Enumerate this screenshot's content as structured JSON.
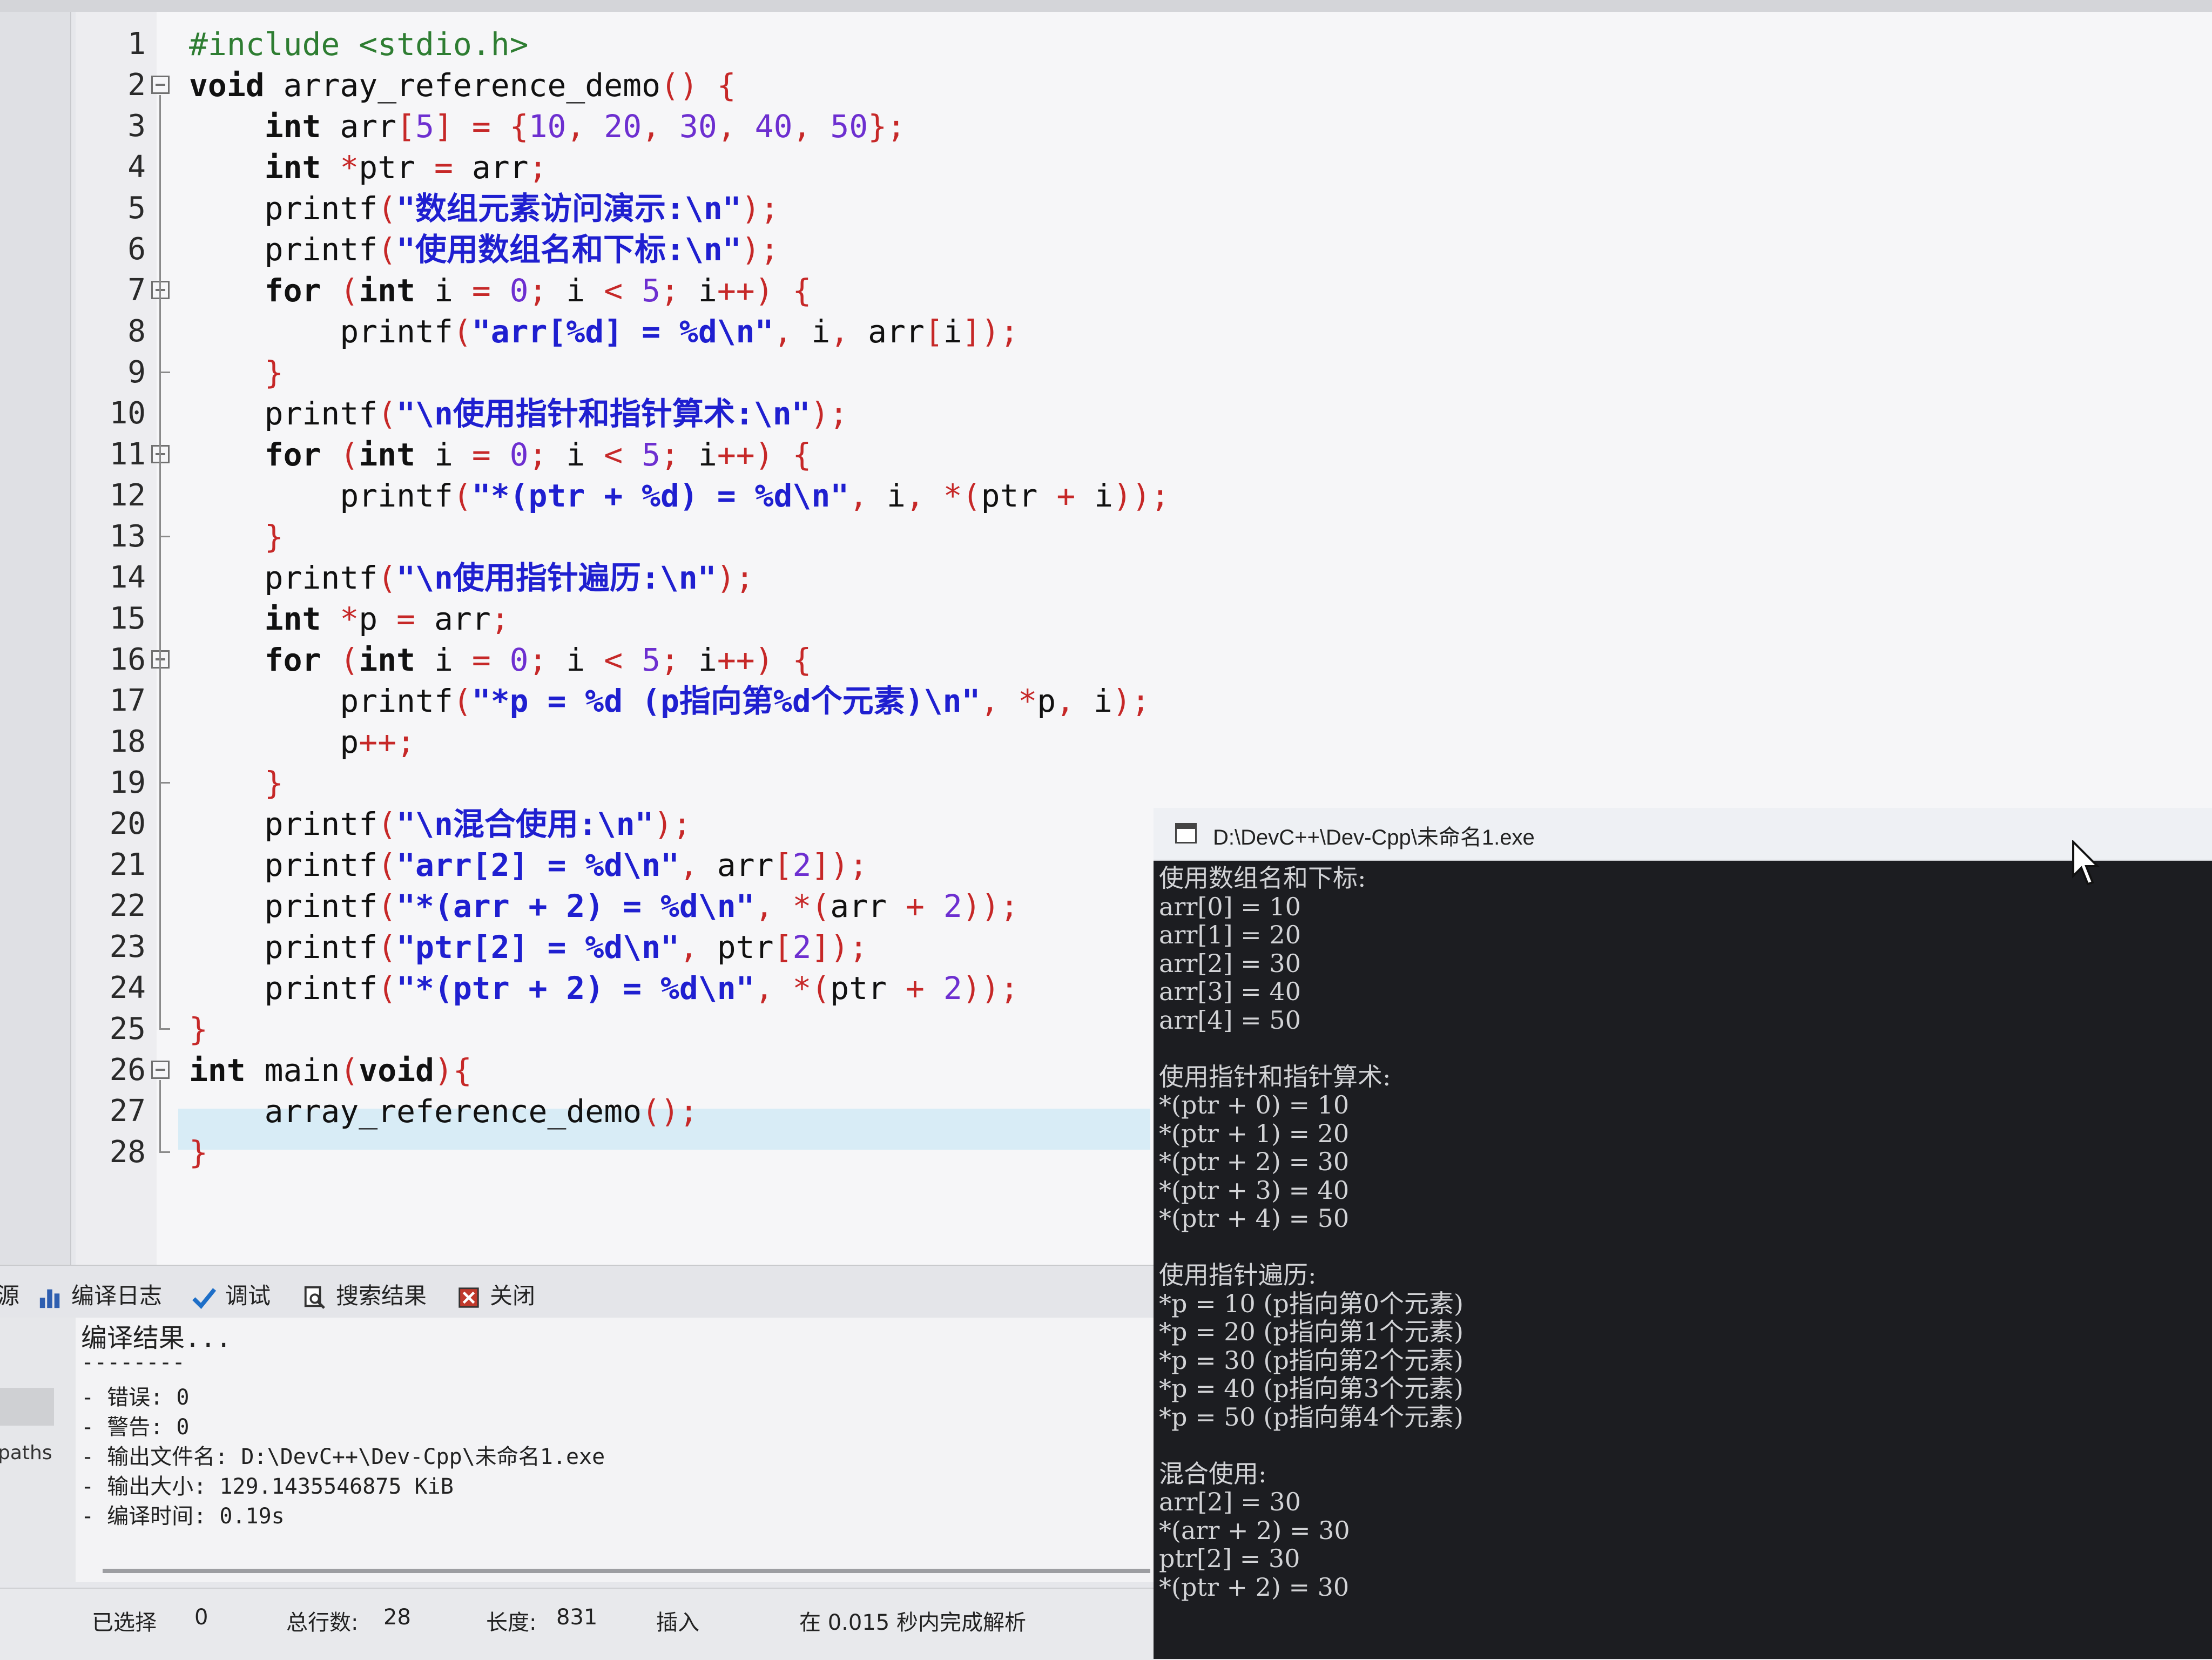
{
  "editor": {
    "lines": [
      {
        "n": "1",
        "text": "#include <stdio.h>"
      },
      {
        "n": "2",
        "text": "void array_reference_demo() {"
      },
      {
        "n": "3",
        "text": "    int arr[5] = {10, 20, 30, 40, 50};"
      },
      {
        "n": "4",
        "text": "    int *ptr = arr;"
      },
      {
        "n": "5",
        "text": "    printf(\"数组元素访问演示:\\n\");"
      },
      {
        "n": "6",
        "text": "    printf(\"使用数组名和下标:\\n\");"
      },
      {
        "n": "7",
        "text": "    for (int i = 0; i < 5; i++) {"
      },
      {
        "n": "8",
        "text": "        printf(\"arr[%d] = %d\\n\", i, arr[i]);"
      },
      {
        "n": "9",
        "text": "    }"
      },
      {
        "n": "10",
        "text": "    printf(\"\\n使用指针和指针算术:\\n\");"
      },
      {
        "n": "11",
        "text": "    for (int i = 0; i < 5; i++) {"
      },
      {
        "n": "12",
        "text": "        printf(\"*(ptr + %d) = %d\\n\", i, *(ptr + i));"
      },
      {
        "n": "13",
        "text": "    }"
      },
      {
        "n": "14",
        "text": "    printf(\"\\n使用指针遍历:\\n\");"
      },
      {
        "n": "15",
        "text": "    int *p = arr;"
      },
      {
        "n": "16",
        "text": "    for (int i = 0; i < 5; i++) {"
      },
      {
        "n": "17",
        "text": "        printf(\"*p = %d (p指向第%d个元素)\\n\", *p, i);"
      },
      {
        "n": "18",
        "text": "        p++;"
      },
      {
        "n": "19",
        "text": "    }"
      },
      {
        "n": "20",
        "text": "    printf(\"\\n混合使用:\\n\");"
      },
      {
        "n": "21",
        "text": "    printf(\"arr[2] = %d\\n\", arr[2]);"
      },
      {
        "n": "22",
        "text": "    printf(\"*(arr + 2) = %d\\n\", *(arr + 2));"
      },
      {
        "n": "23",
        "text": "    printf(\"ptr[2] = %d\\n\", ptr[2]);"
      },
      {
        "n": "24",
        "text": "    printf(\"*(ptr + 2) = %d\\n\", *(ptr + 2));"
      },
      {
        "n": "25",
        "text": "}"
      },
      {
        "n": "26",
        "text": "int main(void){"
      },
      {
        "n": "27",
        "text": "    array_reference_demo();"
      },
      {
        "n": "28",
        "text": "}"
      }
    ],
    "fold_lines": [
      "2",
      "7",
      "11",
      "16",
      "26"
    ]
  },
  "console": {
    "title": "D:\\DevC++\\Dev-Cpp\\未命名1.exe",
    "lines": [
      "使用数组名和下标:",
      "arr[0] = 10",
      "arr[1] = 20",
      "arr[2] = 30",
      "arr[3] = 40",
      "arr[4] = 50",
      "",
      "使用指针和指针算术:",
      "*(ptr + 0) = 10",
      "*(ptr + 1) = 20",
      "*(ptr + 2) = 30",
      "*(ptr + 3) = 40",
      "*(ptr + 4) = 50",
      "",
      "使用指针遍历:",
      "*p = 10 (p指向第0个元素)",
      "*p = 20 (p指向第1个元素)",
      "*p = 30 (p指向第2个元素)",
      "*p = 40 (p指向第3个元素)",
      "*p = 50 (p指向第4个元素)",
      "",
      "混合使用:",
      "arr[2] = 30",
      "*(arr + 2) = 30",
      "ptr[2] = 30",
      "*(ptr + 2) = 30"
    ]
  },
  "tabs": {
    "partial_left": "源",
    "compile_log": "编译日志",
    "debug": "调试",
    "search_results": "搜索结果",
    "close": "关闭"
  },
  "log": {
    "partial_paths": "paths",
    "heading": "编译结果...",
    "separator": "--------",
    "errors": "- 错误: 0",
    "warnings": "- 警告: 0",
    "output_file": "- 输出文件名: D:\\DevC++\\Dev-Cpp\\未命名1.exe",
    "output_size": "- 输出大小: 129.1435546875 KiB",
    "compile_time": "- 编译时间: 0.19s"
  },
  "status": {
    "selected_label": "已选择",
    "selected_value": "0",
    "total_lines_label": "总行数:",
    "total_lines_value": "28",
    "length_label": "长度:",
    "length_value": "831",
    "mode": "插入",
    "parse_info": "在 0.015 秒内完成解析"
  },
  "colors": {
    "keyword": "#111111",
    "string": "#1f1fd0",
    "number": "#6d2fd0",
    "operator": "#c62828",
    "preprocessor": "#2e7d32",
    "console_bg": "#1c1d21",
    "console_text": "#d2d3d6",
    "highlight_line": "#d8ecf6"
  }
}
